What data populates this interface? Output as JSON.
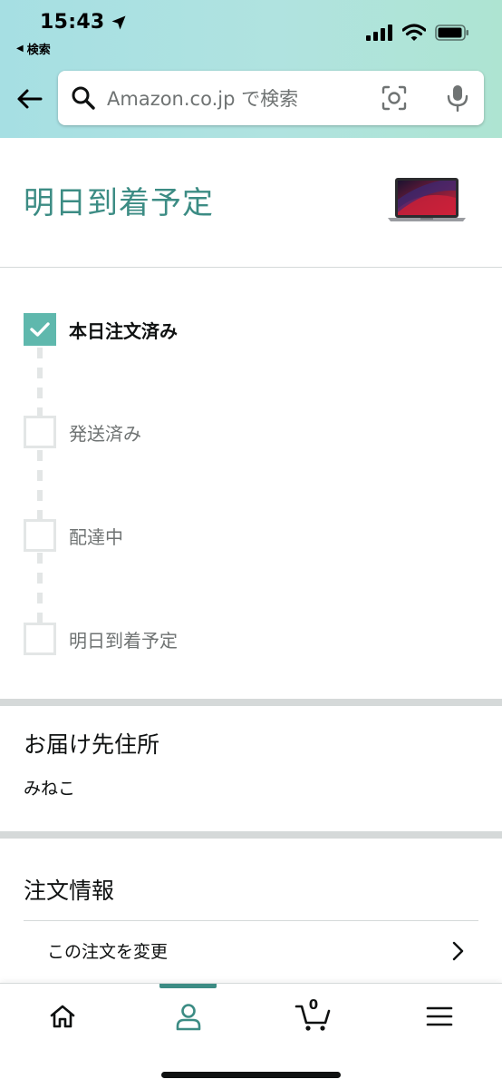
{
  "status_bar": {
    "time": "15:43",
    "back_to_app": "検索"
  },
  "search": {
    "placeholder": "Amazon.co.jp で検索"
  },
  "arrival": {
    "title": "明日到着予定"
  },
  "timeline": {
    "steps": [
      {
        "label": "本日注文済み",
        "done": true
      },
      {
        "label": "発送済み",
        "done": false
      },
      {
        "label": "配達中",
        "done": false
      },
      {
        "label": "明日到着予定",
        "done": false
      }
    ]
  },
  "address": {
    "title": "お届け先住所",
    "name": "みねこ"
  },
  "order_info": {
    "title": "注文情報",
    "change_label": "この注文を変更"
  },
  "bottom_nav": {
    "cart_count": "0",
    "items": [
      "home-icon",
      "account-icon",
      "cart-icon",
      "menu-icon"
    ],
    "active": "account-icon"
  },
  "colors": {
    "accent": "#3c8c84",
    "check": "#5fb8ad",
    "header_gradient_start": "#a6dfe3",
    "header_gradient_end": "#aee4d2"
  }
}
